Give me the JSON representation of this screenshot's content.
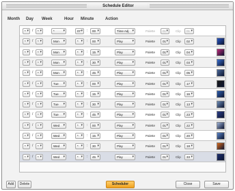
{
  "window": {
    "title": "Schedule Editor"
  },
  "columns": {
    "month": "Month",
    "day": "Day",
    "week": "Week",
    "hour": "Hour",
    "minute": "Minute",
    "action": "Action"
  },
  "common": {
    "month_value": "*",
    "day_value": "*",
    "separator_slash": "/",
    "separator_colon": ":",
    "palette_label": "Palette",
    "clip_label": "Clip",
    "palette_value": "01"
  },
  "rows": [
    {
      "week": "*",
      "hour": "07",
      "minute": "00",
      "action": "Time Adj",
      "clip": "01",
      "disabled": true,
      "thumb_color": ""
    },
    {
      "week": "Mon",
      "hour": "*",
      "minute": "00",
      "action": "Play",
      "clip": "02",
      "disabled": false,
      "thumb_color": "#2a57c4"
    },
    {
      "week": "Mon",
      "hour": "*",
      "minute": "15",
      "action": "Play",
      "clip": "04",
      "disabled": false,
      "thumb_color": "#c02a7a"
    },
    {
      "week": "Mon",
      "hour": "*",
      "minute": "30",
      "action": "Play",
      "clip": "03",
      "disabled": false,
      "thumb_color": "#3a6fd0"
    },
    {
      "week": "Mon",
      "hour": "*",
      "minute": "45",
      "action": "Play",
      "clip": "05",
      "disabled": false,
      "thumb_color": "#4c6a9a"
    },
    {
      "week": "Tue",
      "hour": "*",
      "minute": "00",
      "action": "Play",
      "clip": "17",
      "disabled": false,
      "thumb_color": "#1a1a1a"
    },
    {
      "week": "Tue",
      "hour": "*",
      "minute": "15",
      "action": "Play",
      "clip": "16",
      "disabled": false,
      "thumb_color": "#2e5fb0"
    },
    {
      "week": "Tue",
      "hour": "*",
      "minute": "30",
      "action": "Play",
      "clip": "13",
      "disabled": false,
      "thumb_color": "#6f8fb8"
    },
    {
      "week": "Tue",
      "hour": "*",
      "minute": "45",
      "action": "Play",
      "clip": "23",
      "disabled": false,
      "thumb_color": "#2c3f8a"
    },
    {
      "week": "Wed",
      "hour": "*",
      "minute": "00",
      "action": "Play",
      "clip": "22",
      "disabled": false,
      "thumb_color": "#a0b4d8"
    },
    {
      "week": "Wed",
      "hour": "*",
      "minute": "15",
      "action": "Play",
      "clip": "20",
      "disabled": false,
      "thumb_color": "#5b86c9"
    },
    {
      "week": "Wed",
      "hour": "*",
      "minute": "30",
      "action": "Play",
      "clip": "18",
      "disabled": false,
      "thumb_color": "#d96a1a"
    },
    {
      "week": "Wed",
      "hour": "*",
      "minute": "45",
      "action": "Play",
      "clip": "33",
      "disabled": false,
      "thumb_color": "#1d2f6e"
    }
  ],
  "footer": {
    "add_label": "Add",
    "delete_label": "Delete",
    "scheduler_label": "Scheduler",
    "close_label": "Close",
    "save_label": "Save"
  }
}
